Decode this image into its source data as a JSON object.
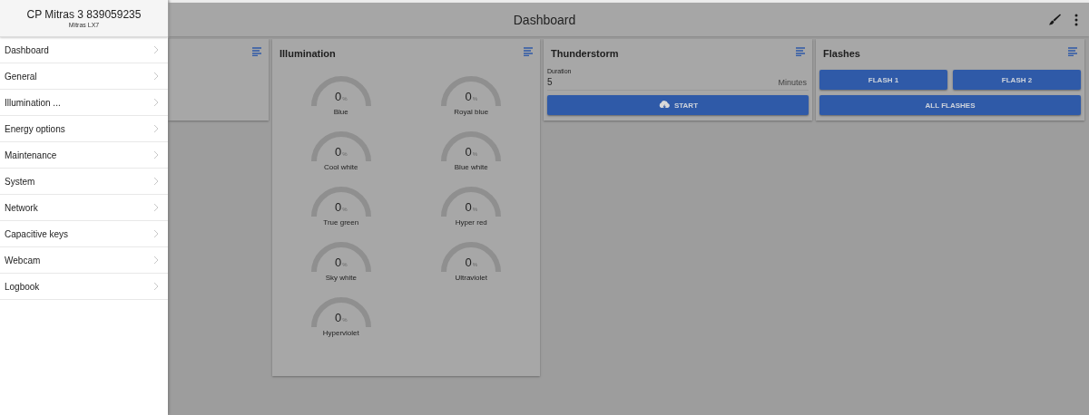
{
  "drawer": {
    "title": "CP Mitras 3 839059235",
    "subtitle": "Mitras LX7",
    "items": [
      {
        "label": "Dashboard"
      },
      {
        "label": "General"
      },
      {
        "label": "Illumination ..."
      },
      {
        "label": "Energy options"
      },
      {
        "label": "Maintenance"
      },
      {
        "label": "System"
      },
      {
        "label": "Network"
      },
      {
        "label": "Capacitive keys"
      },
      {
        "label": "Webcam"
      },
      {
        "label": "Logbook"
      }
    ]
  },
  "app_bar": {
    "title": "Dashboard"
  },
  "illumination": {
    "title": "Illumination",
    "channels": [
      {
        "name": "Blue",
        "value": "0",
        "unit": "%"
      },
      {
        "name": "Royal blue",
        "value": "0",
        "unit": "%"
      },
      {
        "name": "Cool white",
        "value": "0",
        "unit": "%"
      },
      {
        "name": "Blue white",
        "value": "0",
        "unit": "%"
      },
      {
        "name": "True green",
        "value": "0",
        "unit": "%"
      },
      {
        "name": "Hyper red",
        "value": "0",
        "unit": "%"
      },
      {
        "name": "Sky white",
        "value": "0",
        "unit": "%"
      },
      {
        "name": "Ultraviolet",
        "value": "0",
        "unit": "%"
      },
      {
        "name": "Hyperviolet",
        "value": "0",
        "unit": "%"
      }
    ]
  },
  "thunderstorm": {
    "title": "Thunderstorm",
    "field_label": "Duration",
    "value": "5",
    "unit": "Minutes",
    "button": "START"
  },
  "flashes": {
    "title": "Flashes",
    "buttons": [
      "FLASH 1",
      "FLASH 2",
      "ALL FLASHES"
    ]
  }
}
